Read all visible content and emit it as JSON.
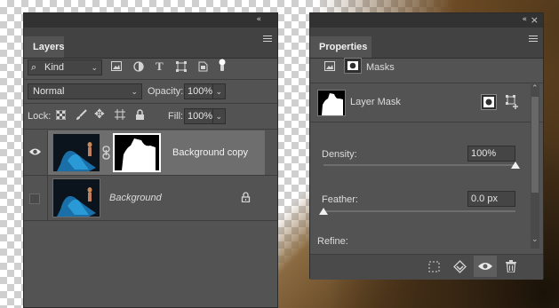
{
  "layers_panel": {
    "tab_label": "Layers",
    "filter_kind": "Kind",
    "blend_mode": "Normal",
    "opacity_label": "Opacity:",
    "opacity_value": "100%",
    "lock_label": "Lock:",
    "fill_label": "Fill:",
    "fill_value": "100%",
    "layers": [
      {
        "name": "Background copy",
        "visible": true,
        "has_mask": true,
        "selected": true
      },
      {
        "name": "Background",
        "visible": false,
        "locked": true,
        "selected": false
      }
    ]
  },
  "properties_panel": {
    "tab_label": "Properties",
    "masks_label": "Masks",
    "layer_mask_label": "Layer Mask",
    "density_label": "Density:",
    "density_value": "100%",
    "density_level": 1.0,
    "feather_label": "Feather:",
    "feather_value": "0.0 px",
    "feather_level": 0.0,
    "refine_label": "Refine:"
  },
  "icons": {
    "collapse": "«",
    "close": "×"
  }
}
